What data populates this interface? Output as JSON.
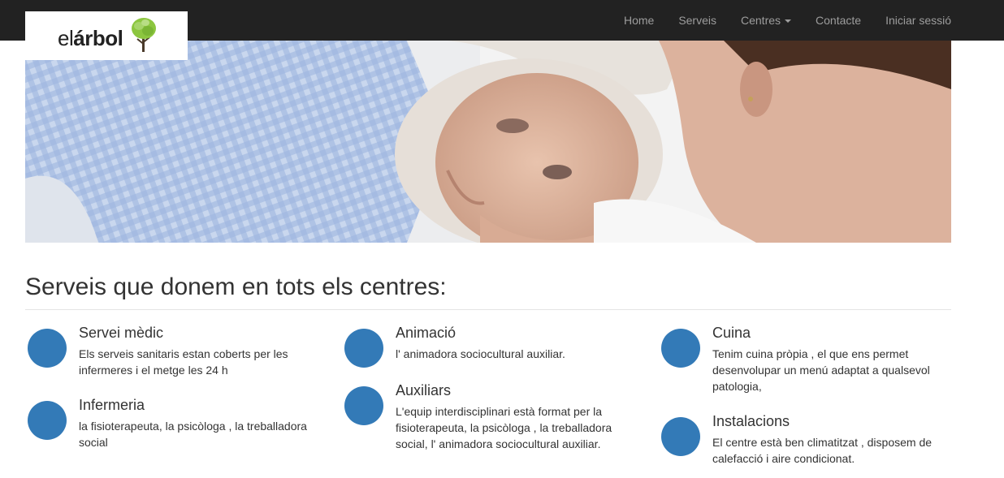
{
  "brand": {
    "prefix": "el",
    "name": "árbol",
    "icon": "tree-icon"
  },
  "nav": {
    "home": "Home",
    "serveis": "Serveis",
    "centres": "Centres",
    "contacte": "Contacte",
    "login": "Iniciar sessió"
  },
  "hero": {
    "icon": "hero-photo-elderly-woman-with-caregiver"
  },
  "section": {
    "title": "Serveis que donem en tots els centres:"
  },
  "services": [
    {
      "heading": "Servei mèdic",
      "text": "Els serveis sanitaris estan coberts per les infermeres i el metge les 24 h"
    },
    {
      "heading": "Infermeria",
      "text": "la fisioterapeuta, la psicòloga , la treballadora social"
    },
    {
      "heading": "Animació",
      "text": "l' animadora sociocultural auxiliar."
    },
    {
      "heading": "Auxiliars",
      "text": "L'equip interdisciplinari està format per la fisioterapeuta, la psicòloga , la treballadora social, l' animadora sociocultural auxiliar."
    },
    {
      "heading": "Cuina",
      "text": "Tenim cuina pròpia , el que ens permet desenvolupar un menú adaptat a qualsevol patologia,"
    },
    {
      "heading": "Instalacions",
      "text": "El centre està ben climatitzat , disposem de calefacció i aire condicionat."
    }
  ],
  "colors": {
    "navbar": "#222222",
    "nav_text": "#9d9d9d",
    "accent": "#337ab7"
  }
}
